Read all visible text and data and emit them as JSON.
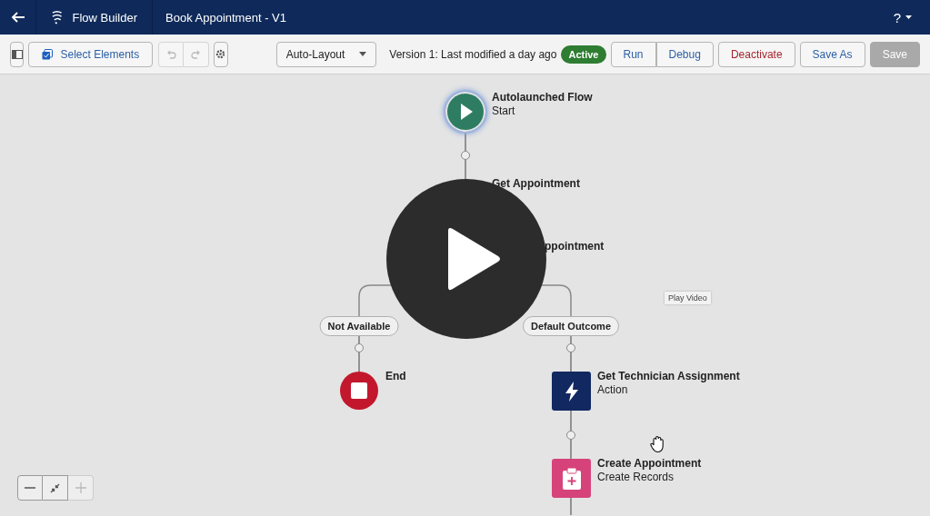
{
  "header": {
    "app_name": "Flow Builder",
    "flow_title": "Book Appointment - V1",
    "help": "?"
  },
  "toolbar": {
    "select_elements": "Select Elements",
    "layout": "Auto-Layout",
    "version_info": "Version 1: Last modified a day ago",
    "status_badge": "Active",
    "buttons": [
      {
        "label": "Run",
        "kind": "grouped",
        "disabled": false
      },
      {
        "label": "Debug",
        "kind": "grouped",
        "disabled": false
      },
      {
        "label": "Deactivate",
        "kind": "destructive",
        "disabled": false
      },
      {
        "label": "Save As",
        "kind": "plain",
        "disabled": false
      },
      {
        "label": "Save",
        "kind": "brand",
        "disabled": true
      }
    ]
  },
  "canvas": {
    "nodes": [
      {
        "kind": "start",
        "label": "Autolaunched Flow",
        "subtitle": "Start"
      },
      {
        "kind": "hidden",
        "label": "Get Appointment"
      },
      {
        "kind": "hidden",
        "label": "ppointment"
      },
      {
        "kind": "end",
        "label": "End"
      },
      {
        "kind": "action",
        "label": "Get Technician Assignment",
        "subtitle": "Action"
      },
      {
        "kind": "create",
        "label": "Create Appointment",
        "subtitle": "Create Records"
      }
    ],
    "outcomes": [
      "Not Available",
      "Default Outcome"
    ],
    "tooltip": "Play Video"
  }
}
